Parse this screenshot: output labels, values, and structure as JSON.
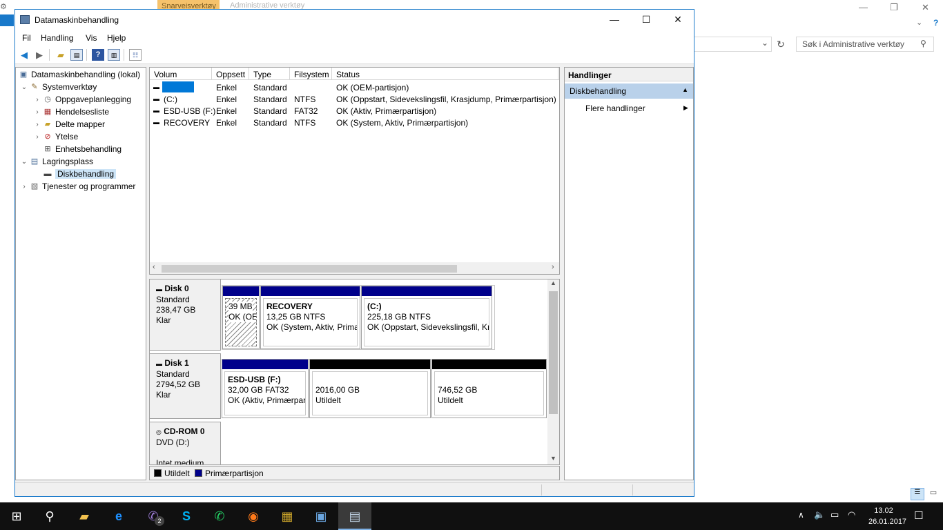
{
  "background_window": {
    "tab_active": "Snarveisverktøy",
    "tab_inactive": "Administrative verktøy",
    "search_placeholder": "Søk i Administrative verktøy"
  },
  "window": {
    "title": "Datamaskinbehandling",
    "minimize": "—",
    "maximize": "☐",
    "close": "✕"
  },
  "menu": [
    "Fil",
    "Handling",
    "Vis",
    "Hjelp"
  ],
  "tree": [
    {
      "label": "Datamaskinbehandling (lokal)",
      "icon": "computer-icon",
      "level": 0
    },
    {
      "label": "Systemverktøy",
      "icon": "tools-icon",
      "level": 1,
      "expander": "expanded"
    },
    {
      "label": "Oppgaveplanlegging",
      "icon": "clock-icon",
      "level": 2,
      "expander": "collapsed"
    },
    {
      "label": "Hendelsesliste",
      "icon": "event-viewer-icon",
      "level": 2,
      "expander": "collapsed"
    },
    {
      "label": "Delte mapper",
      "icon": "shared-folder-icon",
      "level": 2,
      "expander": "collapsed"
    },
    {
      "label": "Ytelse",
      "icon": "performance-icon",
      "level": 2,
      "expander": "collapsed"
    },
    {
      "label": "Enhetsbehandling",
      "icon": "device-manager-icon",
      "level": 2
    },
    {
      "label": "Lagringsplass",
      "icon": "storage-icon",
      "level": 1,
      "expander": "expanded"
    },
    {
      "label": "Diskbehandling",
      "icon": "disk-management-icon",
      "level": 2,
      "selected": true
    },
    {
      "label": "Tjenester og programmer",
      "icon": "services-icon",
      "level": 1,
      "expander": "collapsed"
    }
  ],
  "volume_table": {
    "columns": [
      "Volum",
      "Oppsett",
      "Type",
      "Filsystem",
      "Status"
    ],
    "rows": [
      {
        "volum": "",
        "oppsett": "Enkel",
        "type": "Standard",
        "filsystem": "",
        "status": "OK (OEM-partisjon)"
      },
      {
        "volum": "(C:)",
        "oppsett": "Enkel",
        "type": "Standard",
        "filsystem": "NTFS",
        "status": "OK (Oppstart, Sidevekslingsfil, Krasjdump, Primærpartisjon)"
      },
      {
        "volum": "ESD-USB (F:)",
        "oppsett": "Enkel",
        "type": "Standard",
        "filsystem": "FAT32",
        "status": "OK (Aktiv, Primærpartisjon)"
      },
      {
        "volum": "RECOVERY",
        "oppsett": "Enkel",
        "type": "Standard",
        "filsystem": "NTFS",
        "status": "OK (System, Aktiv, Primærpartisjon)"
      }
    ]
  },
  "disks": [
    {
      "name": "Disk 0",
      "type": "Standard",
      "size": "238,47 GB",
      "state": "Klar",
      "partitions": [
        {
          "title": "",
          "line1": "39 MB",
          "line2": "OK (OEI",
          "color": "#00008b",
          "hatched": true
        },
        {
          "title": "RECOVERY",
          "line1": "13,25 GB NTFS",
          "line2": "OK (System, Aktiv, Prima",
          "color": "#00008b"
        },
        {
          "title": "(C:)",
          "line1": "225,18 GB NTFS",
          "line2": "OK (Oppstart, Sidevekslingsfil, Kra",
          "color": "#00008b"
        }
      ]
    },
    {
      "name": "Disk 1",
      "type": "Standard",
      "size": "2794,52 GB",
      "state": "Klar",
      "partitions": [
        {
          "title": "ESD-USB  (F:)",
          "line1": "32,00 GB FAT32",
          "line2": "OK (Aktiv, Primærpar",
          "color": "#00008b"
        },
        {
          "title": "",
          "line1": "2016,00 GB",
          "line2": "Utildelt",
          "color": "#000000"
        },
        {
          "title": "",
          "line1": "746,52 GB",
          "line2": "Utildelt",
          "color": "#000000"
        }
      ]
    },
    {
      "name": "CD-ROM 0",
      "type": "DVD (D:)",
      "size": "",
      "state": "Intet medium"
    }
  ],
  "legend": [
    {
      "label": "Utildelt",
      "color": "#000000"
    },
    {
      "label": "Primærpartisjon",
      "color": "#00008b"
    }
  ],
  "actions": {
    "header": "Handlinger",
    "section": "Diskbehandling",
    "more": "Flere handlinger"
  },
  "taskbar": {
    "time": "13.02",
    "date": "26.01.2017",
    "viber_badge": "2"
  }
}
